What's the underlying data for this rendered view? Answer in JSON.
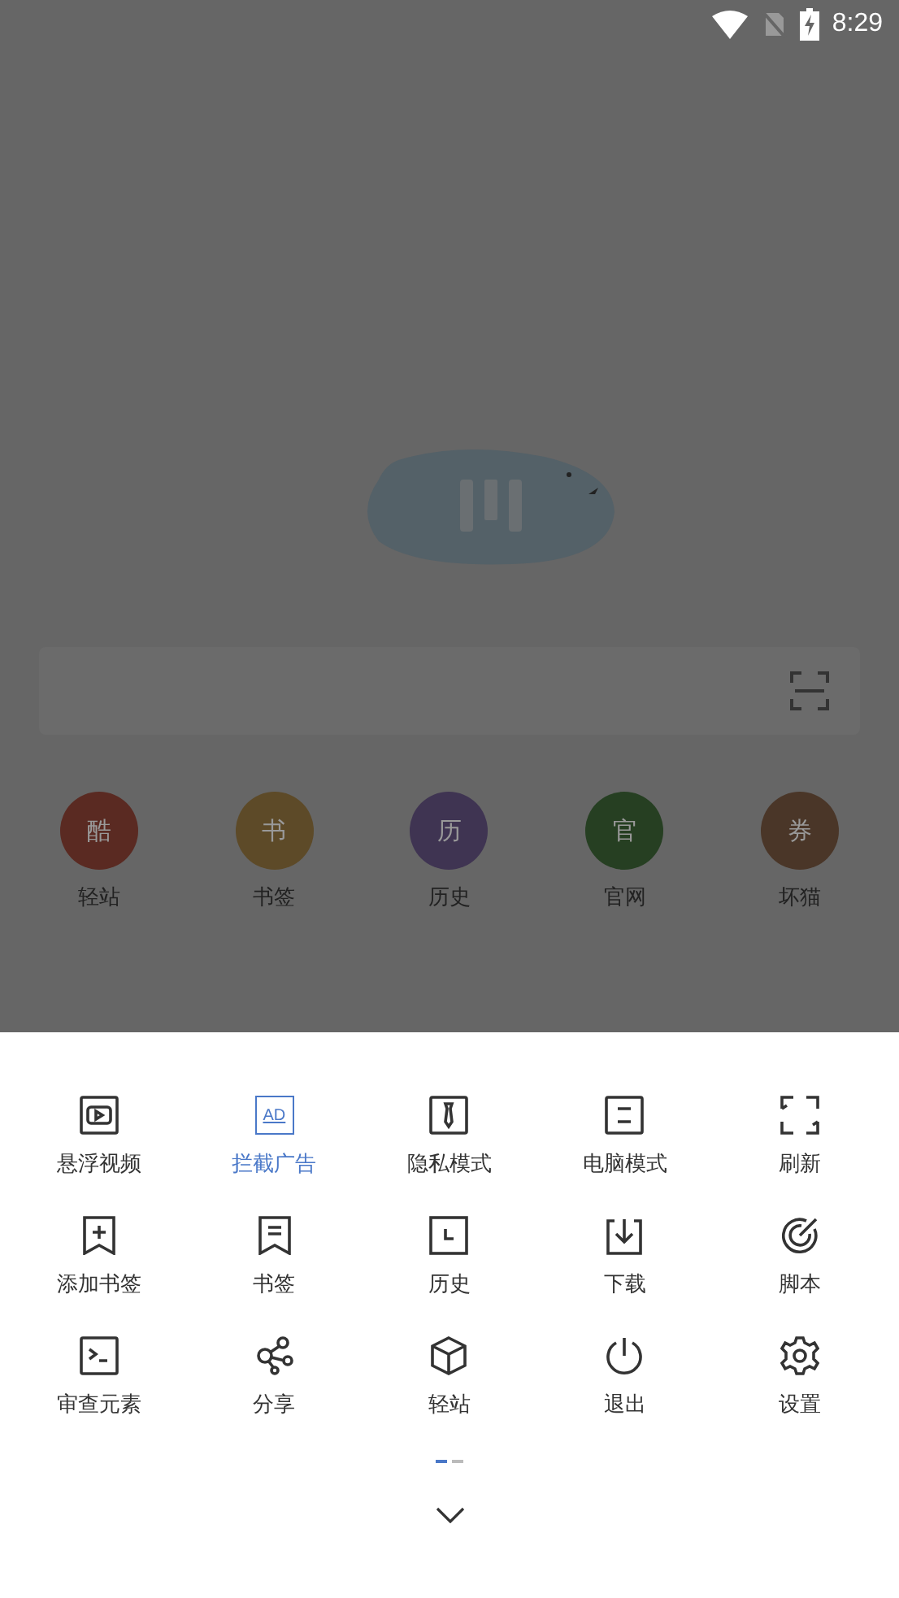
{
  "status_bar": {
    "time": "8:29"
  },
  "shortcuts": [
    {
      "glyph": "酷",
      "label": "轻站",
      "color": "#5a2a22"
    },
    {
      "glyph": "书",
      "label": "书签",
      "color": "#5d4a28"
    },
    {
      "glyph": "历",
      "label": "历史",
      "color": "#3f3452"
    },
    {
      "glyph": "官",
      "label": "官网",
      "color": "#263f22"
    },
    {
      "glyph": "券",
      "label": "坏猫",
      "color": "#4a3628"
    }
  ],
  "menu": {
    "items": [
      {
        "kind": "video",
        "label": "悬浮视频",
        "on": false
      },
      {
        "kind": "ad",
        "label": "拦截广告",
        "on": true,
        "icon_text": "AD"
      },
      {
        "kind": "tie",
        "label": "隐私模式",
        "on": false
      },
      {
        "kind": "desktop",
        "label": "电脑模式",
        "on": false
      },
      {
        "kind": "refresh",
        "label": "刷新",
        "on": false
      },
      {
        "kind": "bookmark-add",
        "label": "添加书签",
        "on": false
      },
      {
        "kind": "bookmark",
        "label": "书签",
        "on": false
      },
      {
        "kind": "history",
        "label": "历史",
        "on": false
      },
      {
        "kind": "download",
        "label": "下载",
        "on": false
      },
      {
        "kind": "script",
        "label": "脚本",
        "on": false
      },
      {
        "kind": "terminal",
        "label": "审查元素",
        "on": false
      },
      {
        "kind": "share",
        "label": "分享",
        "on": false
      },
      {
        "kind": "cube",
        "label": "轻站",
        "on": false
      },
      {
        "kind": "power",
        "label": "退出",
        "on": false
      },
      {
        "kind": "gear",
        "label": "设置",
        "on": false
      }
    ],
    "pages": [
      {
        "selected": true
      },
      {
        "selected": false
      }
    ]
  }
}
